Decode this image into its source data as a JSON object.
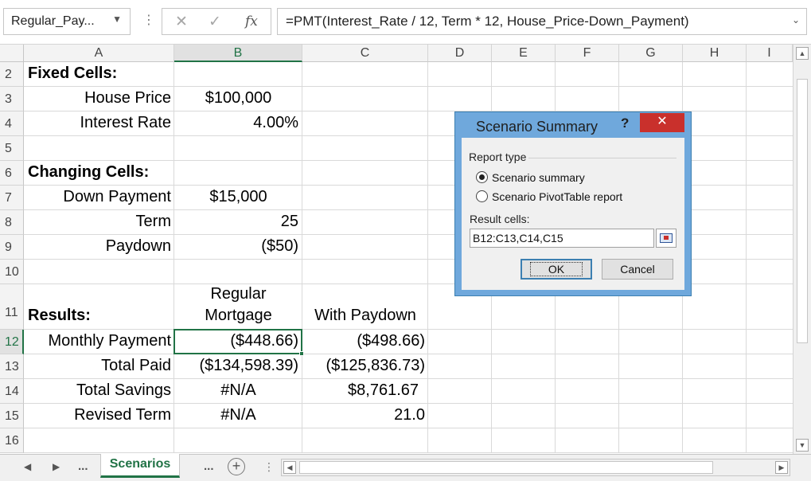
{
  "formula_bar": {
    "name_box": "Regular_Pay...",
    "cancel_icon": "close-icon",
    "enter_icon": "check-icon",
    "fx_label": "fx",
    "formula": "=PMT(Interest_Rate / 12, Term * 12, House_Price-Down_Payment)"
  },
  "columns": [
    "A",
    "B",
    "C",
    "D",
    "E",
    "F",
    "G",
    "H",
    "I"
  ],
  "selected_column": "B",
  "rows": [
    {
      "num": "2",
      "a": "Fixed Cells:",
      "a_bold": true,
      "b": "",
      "c": ""
    },
    {
      "num": "3",
      "a": "House Price",
      "b": "$100,000",
      "c": ""
    },
    {
      "num": "4",
      "a": "Interest Rate",
      "b": "4.00%",
      "c": ""
    },
    {
      "num": "5",
      "a": "",
      "b": "",
      "c": ""
    },
    {
      "num": "6",
      "a": "Changing Cells:",
      "a_bold": true,
      "b": "",
      "c": ""
    },
    {
      "num": "7",
      "a": "Down Payment",
      "b": "$15,000",
      "c": ""
    },
    {
      "num": "8",
      "a": "Term",
      "b": "25",
      "c": ""
    },
    {
      "num": "9",
      "a": "Paydown",
      "b": "($50)",
      "c": ""
    },
    {
      "num": "10",
      "a": "",
      "b": "",
      "c": ""
    },
    {
      "num": "11",
      "a": "Results:",
      "a_bold": true,
      "b_line1": "Regular",
      "b": "Mortgage",
      "c": "With Paydown"
    },
    {
      "num": "12",
      "a": "Monthly Payment",
      "b": "($448.66)",
      "c": "($498.66)"
    },
    {
      "num": "13",
      "a": "Total Paid",
      "b": "($134,598.39)",
      "c": "($125,836.73)"
    },
    {
      "num": "14",
      "a": "Total Savings",
      "b": "#N/A",
      "c": "$8,761.67"
    },
    {
      "num": "15",
      "a": "Revised Term",
      "b": "#N/A",
      "c": "21.0"
    },
    {
      "num": "16",
      "a": "",
      "b": "",
      "c": ""
    }
  ],
  "sheet_tabs": {
    "active": "Scenarios",
    "more": "...",
    "add": "+"
  },
  "dialog": {
    "title": "Scenario Summary",
    "help": "?",
    "close": "✕",
    "group_label": "Report type",
    "option1": "Scenario summary",
    "option2": "Scenario PivotTable report",
    "selected_option": "Scenario summary",
    "result_label": "Result cells:",
    "result_value": "B12:C13,C14,C15",
    "ok": "OK",
    "cancel": "Cancel"
  }
}
